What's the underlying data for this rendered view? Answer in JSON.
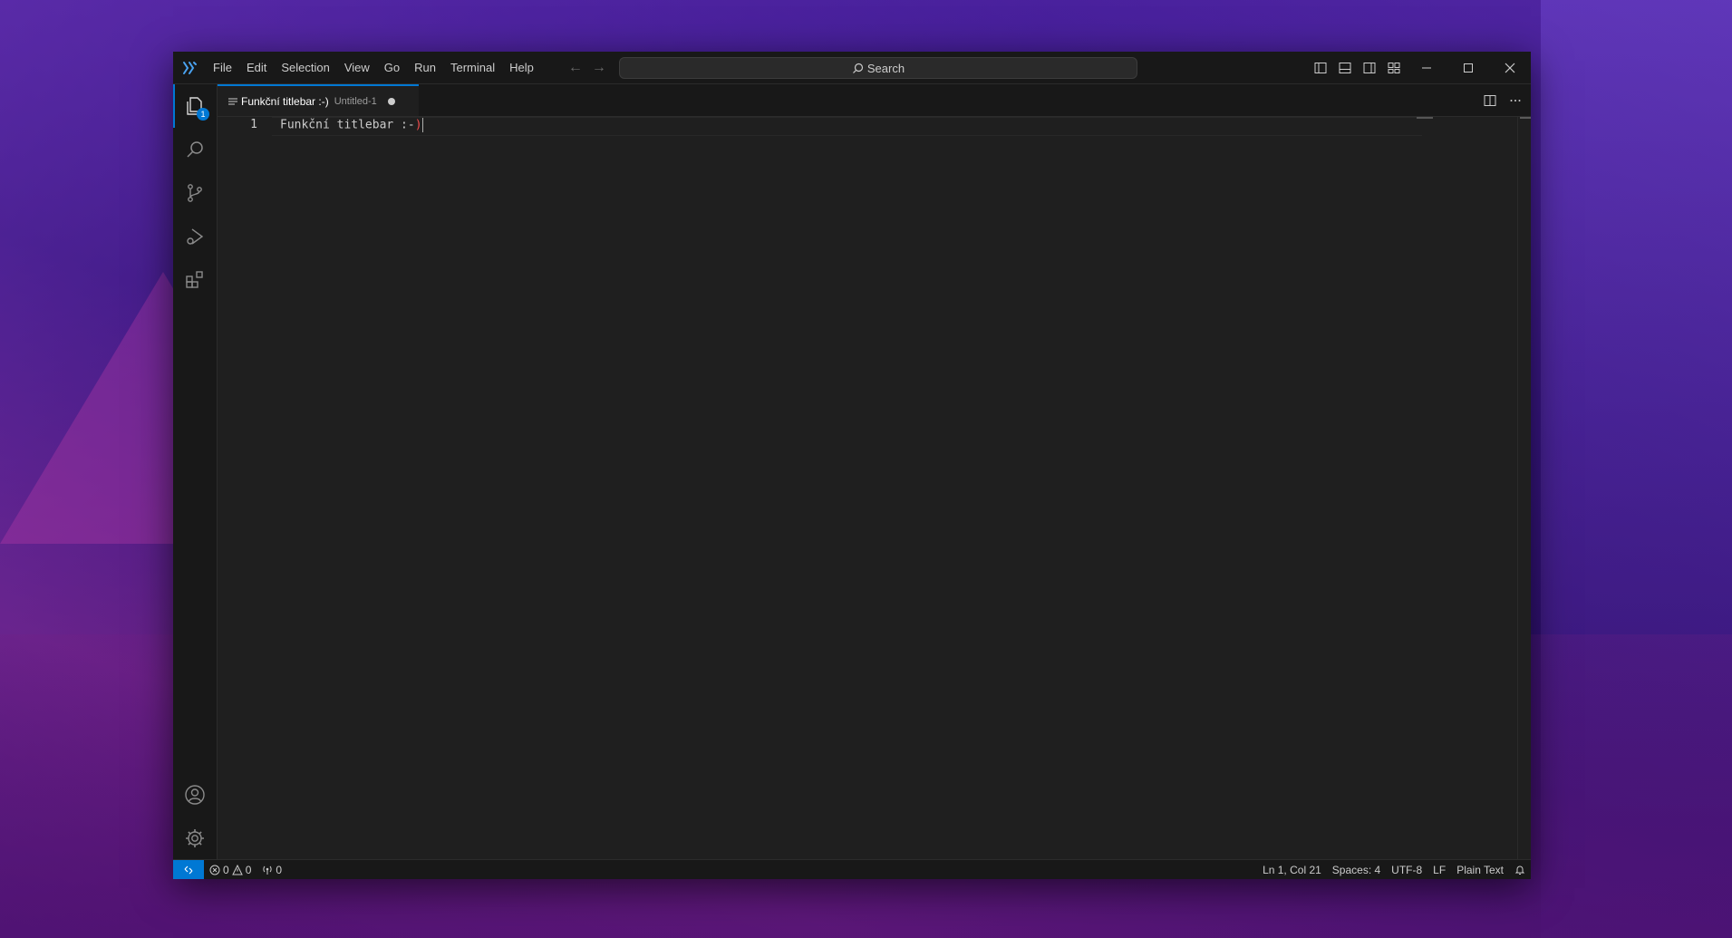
{
  "menu": [
    "File",
    "Edit",
    "Selection",
    "View",
    "Go",
    "Run",
    "Terminal",
    "Help"
  ],
  "search": {
    "label": "Search"
  },
  "activity": {
    "explorer_badge": "1"
  },
  "tab": {
    "title": "Funkční titlebar :-)",
    "description": "Untitled-1"
  },
  "editor": {
    "line_number": "1",
    "line_text": "Funkční titlebar :-",
    "line_paren": ")"
  },
  "status": {
    "errors": "0",
    "warnings": "0",
    "ports": "0",
    "position": "Ln 1, Col 21",
    "spaces": "Spaces: 4",
    "encoding": "UTF-8",
    "eol": "LF",
    "language": "Plain Text"
  },
  "colors": {
    "accent": "#0078d4",
    "background": "#1f1f1f",
    "chrome": "#181818"
  }
}
